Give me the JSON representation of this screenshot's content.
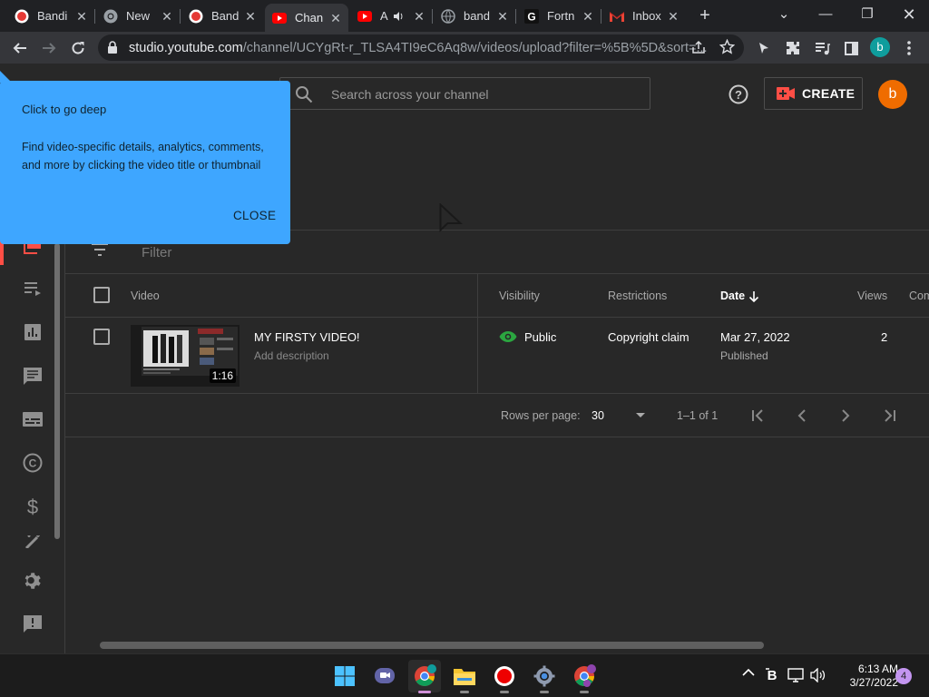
{
  "browser": {
    "tabs": [
      {
        "title": "Bandi",
        "icon": "bandicam-icon",
        "active": false
      },
      {
        "title": "New",
        "icon": "chrome-icon",
        "active": false
      },
      {
        "title": "Band",
        "icon": "bandicam-icon",
        "active": false
      },
      {
        "title": "Chan",
        "icon": "youtube-icon",
        "active": true
      },
      {
        "title": "A",
        "icon": "youtube-icon",
        "active": false,
        "audio": true
      },
      {
        "title": "band",
        "icon": "globe-icon",
        "active": false
      },
      {
        "title": "Fortn",
        "icon": "fortnite-icon",
        "active": false
      },
      {
        "title": "Inbox",
        "icon": "gmail-icon",
        "active": false
      }
    ],
    "url_host": "studio.youtube.com",
    "url_path": "/channel/UCYgRt-r_TLSA4TI9eC6Aq8w/videos/upload?filter=%5B%5D&sort=...",
    "profile_letter": "b"
  },
  "studio": {
    "search_placeholder": "Search across your channel",
    "create_label": "CREATE",
    "avatar_letter": "b",
    "filter_placeholder": "Filter",
    "columns": {
      "video": "Video",
      "visibility": "Visibility",
      "restrictions": "Restrictions",
      "date": "Date",
      "views": "Views",
      "comments": "Com"
    },
    "rows": [
      {
        "title": "MY FIRSTY VIDEO!",
        "description": "Add description",
        "duration": "1:16",
        "visibility": "Public",
        "restrictions": "Copyright claim",
        "date": "Mar 27, 2022",
        "date_status": "Published",
        "views": "2"
      }
    ],
    "pagination": {
      "rows_per_page_label": "Rows per page:",
      "rows_per_page_value": "30",
      "range": "1–1 of 1"
    },
    "tooltip": {
      "title": "Click to go deep",
      "body": "Find video-specific details, analytics, comments, and more by clicking the video title or thumbnail",
      "close_label": "CLOSE"
    }
  },
  "taskbar": {
    "time": "6:13 AM",
    "date": "3/27/2022",
    "notification_count": "4"
  },
  "colors": {
    "accent_blue": "#3ea6ff",
    "brand_red": "#ff0000",
    "public_green": "#2ba640",
    "avatar_orange": "#ef6c00"
  }
}
